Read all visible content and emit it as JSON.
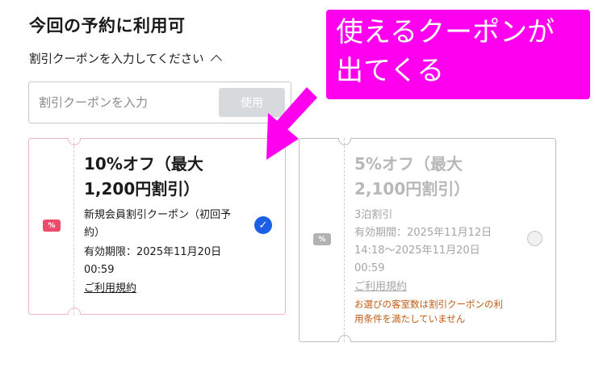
{
  "header": {
    "title": "今回の予約に利用可",
    "coupon_toggle_label": "割引クーポンを入力してください"
  },
  "coupon_input": {
    "placeholder": "割引クーポンを入力",
    "use_button_label": "使用"
  },
  "coupons": [
    {
      "title_line1": "10%オフ（最大",
      "title_line2": "1,200円割引）",
      "description_line1": "新規会員割引クーポン（初回予",
      "description_line2": "約）",
      "validity_line1": "有効期限：2025年11月20日",
      "validity_line2": "00:59",
      "terms_label": "ご利用規約",
      "selected": true
    },
    {
      "title_line1": "5%オフ（最大",
      "title_line2": "2,100円割引）",
      "description_line1": "3泊割引",
      "validity_line1": "有効期間：2025年11月12日",
      "validity_line2": "14:18～2025年11月20日",
      "validity_line3": "00:59",
      "terms_label": "ご利用規約",
      "warning_line1": "お選びの客室数は割引クーポンの利",
      "warning_line2": "用条件を満たしていません",
      "selected": false
    }
  ],
  "annotation": {
    "line1": "使えるクーポンが",
    "line2": "出てくる"
  },
  "colors": {
    "accent_pink": "#ee4c6a",
    "check_blue": "#1a5fe5",
    "callout_magenta": "#ff00ee",
    "warning_orange": "#c05a13"
  },
  "icons": {
    "toggle": "chevron-up-icon",
    "coupon": "coupon-ticket-icon",
    "selected": "checkmark-icon",
    "arrow": "annotation-arrow-icon"
  }
}
